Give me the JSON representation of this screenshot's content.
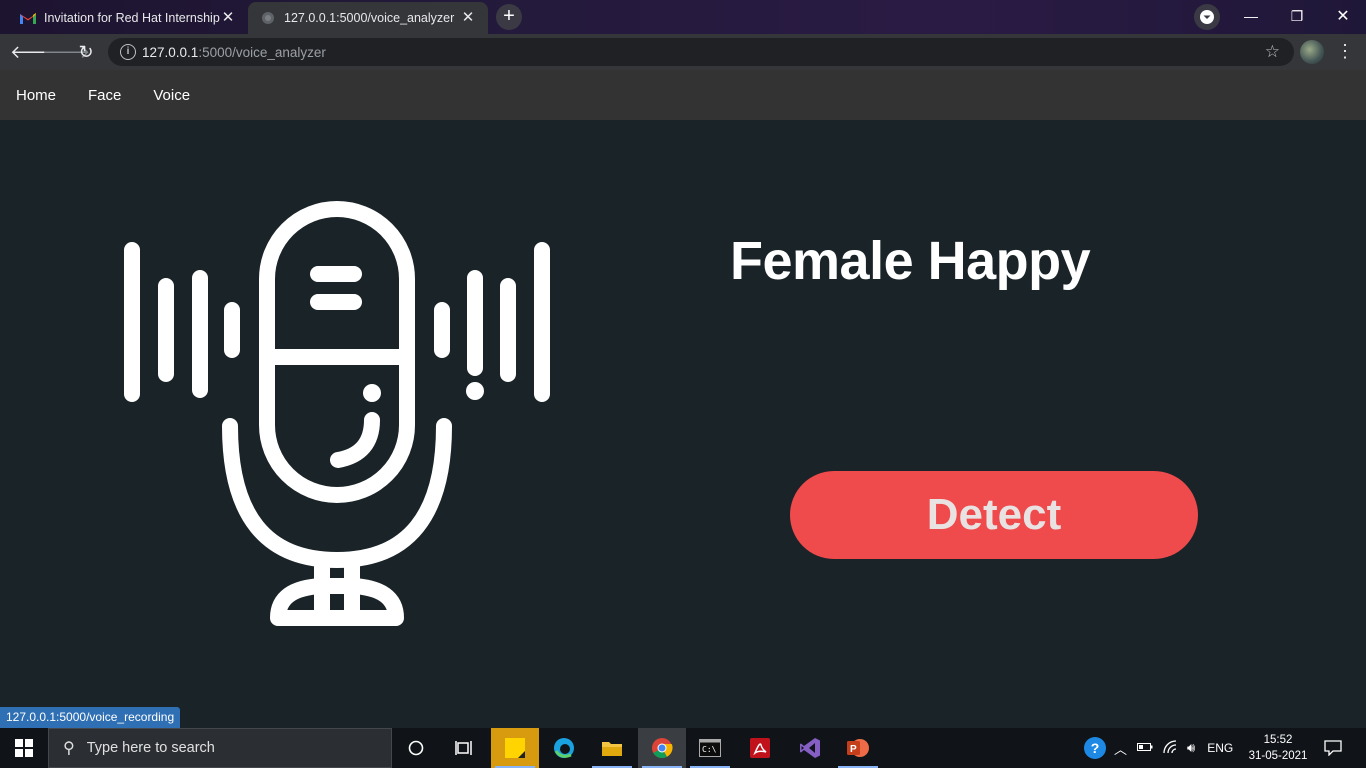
{
  "browser": {
    "tabs": [
      {
        "title": "Invitation for Red Hat Internship",
        "favicon": "gmail-icon",
        "active": false
      },
      {
        "title": "127.0.0.1:5000/voice_analyzer",
        "favicon": "globe-icon",
        "active": true
      }
    ],
    "address": {
      "host": "127.0.0.1",
      "path": ":5000/voice_analyzer"
    },
    "status_url": "127.0.0.1:5000/voice_recording"
  },
  "page": {
    "nav": [
      "Home",
      "Face",
      "Voice"
    ],
    "result": "Female Happy",
    "detect_label": "Detect",
    "accent": "#ef4a4c",
    "background": "#1a2428"
  },
  "taskbar": {
    "search_placeholder": "Type here to search",
    "language": "ENG",
    "time": "15:52",
    "date": "31-05-2021"
  }
}
